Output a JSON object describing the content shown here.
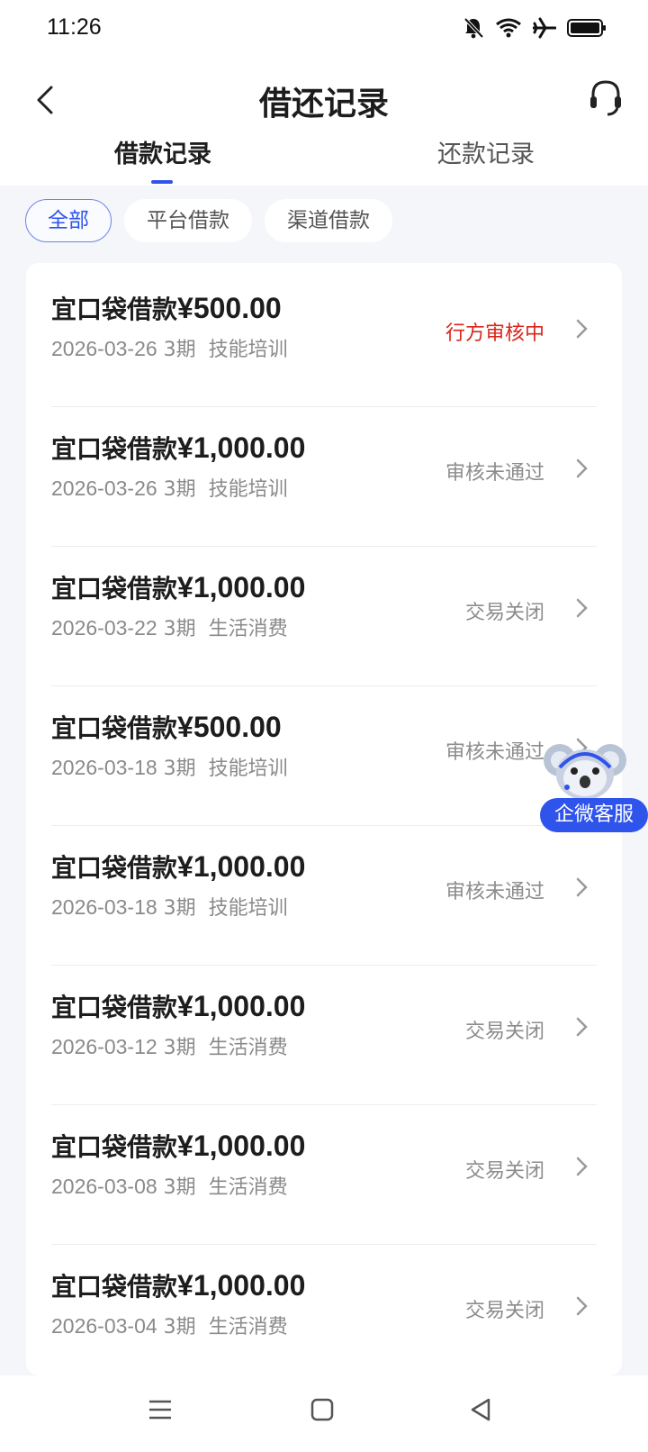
{
  "status_bar": {
    "time": "11:26",
    "icons": [
      "bell-muted-icon",
      "wifi-icon",
      "airplane-icon",
      "battery-icon"
    ]
  },
  "header": {
    "title": "借还记录",
    "back_icon": "chevron-left-icon",
    "support_icon": "headset-icon"
  },
  "tabs": [
    {
      "label": "借款记录",
      "active": true
    },
    {
      "label": "还款记录",
      "active": false
    }
  ],
  "filters": [
    {
      "label": "全部",
      "active": true
    },
    {
      "label": "平台借款",
      "active": false
    },
    {
      "label": "渠道借款",
      "active": false
    }
  ],
  "records": [
    {
      "name": "宜口袋借款",
      "amount": "¥500.00",
      "date": "2026-03-26",
      "term": "3期",
      "purpose": "技能培训",
      "status": "行方审核中",
      "status_color": "#d9261c"
    },
    {
      "name": "宜口袋借款",
      "amount": "¥1,000.00",
      "date": "2026-03-26",
      "term": "3期",
      "purpose": "技能培训",
      "status": "审核未通过",
      "status_color": "#8c8c8c"
    },
    {
      "name": "宜口袋借款",
      "amount": "¥1,000.00",
      "date": "2026-03-22",
      "term": "3期",
      "purpose": "生活消费",
      "status": "交易关闭",
      "status_color": "#8c8c8c"
    },
    {
      "name": "宜口袋借款",
      "amount": "¥500.00",
      "date": "2026-03-18",
      "term": "3期",
      "purpose": "技能培训",
      "status": "审核未通过",
      "status_color": "#8c8c8c"
    },
    {
      "name": "宜口袋借款",
      "amount": "¥1,000.00",
      "date": "2026-03-18",
      "term": "3期",
      "purpose": "技能培训",
      "status": "审核未通过",
      "status_color": "#8c8c8c"
    },
    {
      "name": "宜口袋借款",
      "amount": "¥1,000.00",
      "date": "2026-03-12",
      "term": "3期",
      "purpose": "生活消费",
      "status": "交易关闭",
      "status_color": "#8c8c8c"
    },
    {
      "name": "宜口袋借款",
      "amount": "¥1,000.00",
      "date": "2026-03-08",
      "term": "3期",
      "purpose": "生活消费",
      "status": "交易关闭",
      "status_color": "#8c8c8c"
    },
    {
      "name": "宜口袋借款",
      "amount": "¥1,000.00",
      "date": "2026-03-04",
      "term": "3期",
      "purpose": "生活消费",
      "status": "交易关闭",
      "status_color": "#8c8c8c"
    }
  ],
  "float_support": {
    "label": "企微客服",
    "icon": "koala-mascot-icon"
  },
  "nav_bar": {
    "icons": [
      "menu-icon",
      "home-square-icon",
      "back-triangle-icon"
    ]
  },
  "colors": {
    "accent": "#2f54eb",
    "status_red": "#d9261c",
    "muted": "#8c8c8c"
  }
}
